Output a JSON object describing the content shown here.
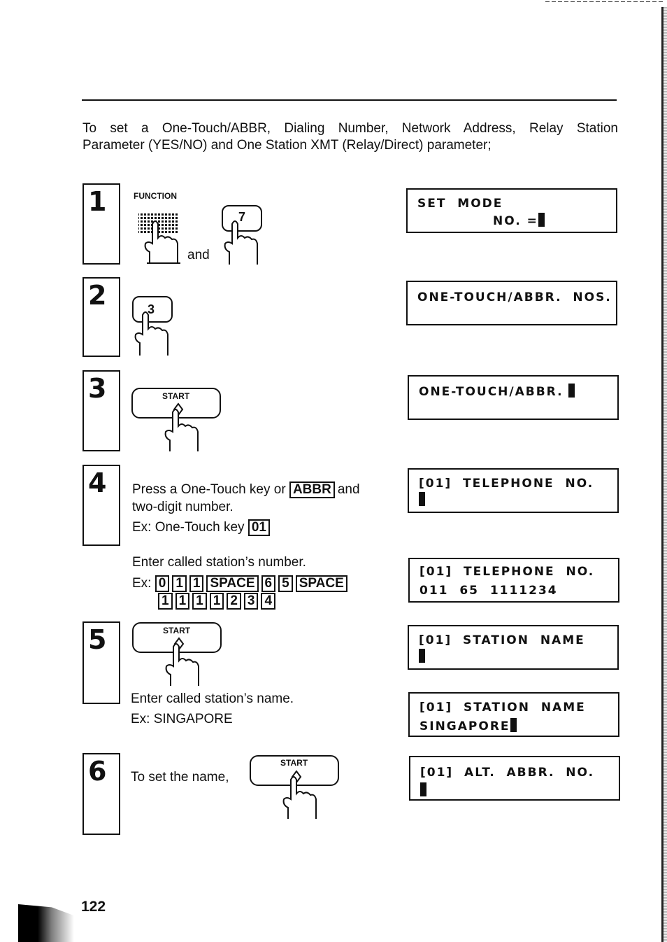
{
  "page": {
    "intro_line1": "To set a One-Touch/ABBR, Dialing Number, Network Address, Relay Station",
    "intro_line2": "Parameter (YES/NO) and One Station XMT (Relay/Direct) parameter;",
    "page_number": "122"
  },
  "steps": [
    {
      "number": "1",
      "function_label": "FUNCTION",
      "key_label": "7",
      "conjunction": "and",
      "display": {
        "line1": "SET  MODE",
        "line2": "NO. =",
        "cursor": true
      }
    },
    {
      "number": "2",
      "key_label": "3",
      "display": {
        "line1": "ONE-TOUCH/ABBR.  NOS.",
        "line2": ""
      }
    },
    {
      "number": "3",
      "key_label": "START",
      "display": {
        "line1": "ONE-TOUCH/ABBR. ",
        "cursor": true
      }
    },
    {
      "number": "4",
      "text_line1_pre": "Press a One-Touch key or",
      "text_line1_key": "ABBR",
      "text_line1_post": "and",
      "text_line2": "two-digit number.",
      "example_prefix": "Ex: One-Touch key",
      "example_key": "01",
      "display": {
        "line1": "[01]  TELEPHONE  NO.",
        "cursor": true
      },
      "enter_number_text": "Enter called station’s number.",
      "enter_number_prefix": "Ex:",
      "number_keys_row1": [
        "0",
        "1",
        "1",
        "SPACE",
        "6",
        "5",
        "SPACE"
      ],
      "number_keys_row2": [
        "1",
        "1",
        "1",
        "1",
        "2",
        "3",
        "4"
      ],
      "display_after": {
        "line1": "[01]  TELEPHONE  NO.",
        "line2": "011  65  1111234"
      }
    },
    {
      "number": "5",
      "key_label": "START",
      "display": {
        "line1": "[01]  STATION  NAME",
        "cursor": true
      },
      "enter_name_text": "Enter called station’s name.",
      "example_name": "Ex: SINGAPORE",
      "display_after": {
        "line1": "[01]  STATION  NAME",
        "line2": "SINGAPORE",
        "cursor": true
      }
    },
    {
      "number": "6",
      "text": "To set the name,",
      "key_label": "START",
      "display": {
        "line1": "[01]  ALT.  ABBR.  NO.",
        "cursor": true
      }
    }
  ]
}
